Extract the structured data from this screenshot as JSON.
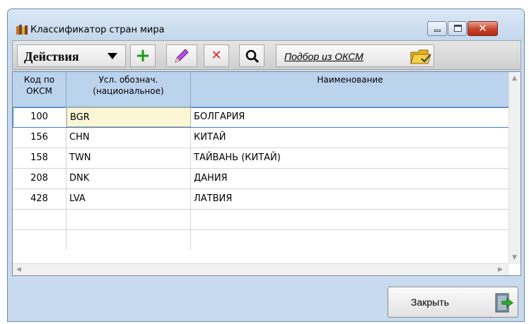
{
  "window": {
    "title": "Классификатор стран мира",
    "icon": "books-icon",
    "controls": {
      "minimize": "minimize-icon",
      "maximize": "maximize-icon",
      "close": "close-icon"
    }
  },
  "toolbar": {
    "actions_label": "Действия",
    "add_icon": "plus-icon",
    "edit_icon": "pencil-icon",
    "delete_icon": "delete-x-icon",
    "find_icon": "magnifier-icon",
    "okcm_label": "Подбор из ОКСМ",
    "okcm_icon": "folder-icon"
  },
  "table": {
    "columns": {
      "code": "Код по ОКСМ",
      "abbr": "Усл. обознач. (национальное)",
      "name": "Наименование"
    },
    "rows": [
      {
        "code": "100",
        "abbr": "BGR",
        "name": "БОЛГАРИЯ",
        "selected": true
      },
      {
        "code": "156",
        "abbr": "CHN",
        "name": "КИТАЙ"
      },
      {
        "code": "158",
        "abbr": "TWN",
        "name": "ТАЙВАНЬ (КИТАЙ)"
      },
      {
        "code": "208",
        "abbr": "DNK",
        "name": "ДАНИЯ"
      },
      {
        "code": "428",
        "abbr": "LVA",
        "name": "ЛАТВИЯ"
      }
    ]
  },
  "footer": {
    "close_label": "Закрыть",
    "close_icon": "exit-door-icon"
  },
  "colors": {
    "window_bg": "#c8dbee",
    "header_bg": "#bcd3ee",
    "selected_cell_bg": "#fbf7d6",
    "add_green": "#1a9a1a",
    "delete_red": "#e02222"
  }
}
